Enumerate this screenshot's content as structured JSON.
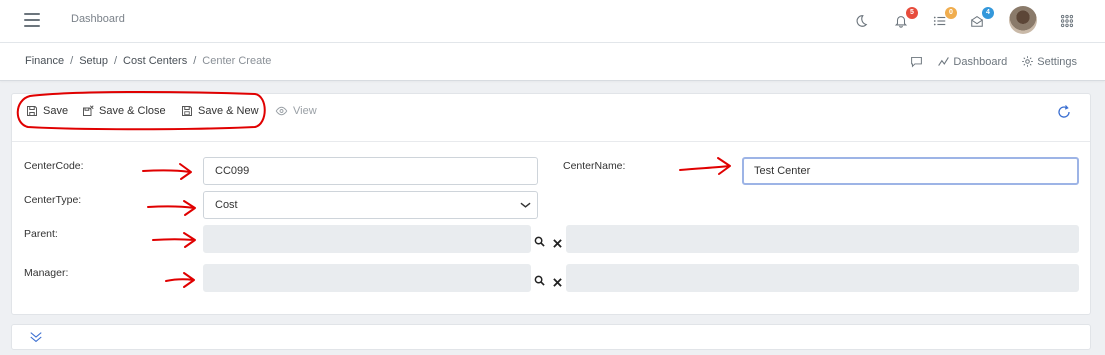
{
  "header": {
    "title": "Dashboard",
    "notifications_badge": "5",
    "tasks_badge": "0",
    "messages_badge": "4",
    "badge_colors": {
      "notifications": "#e74c3c",
      "tasks": "#f0ad4e",
      "messages": "#3498db"
    },
    "icons": [
      "menu-icon",
      "moon-icon",
      "bell-icon",
      "tasks-icon",
      "mail-icon",
      "avatar",
      "apps-grid-icon"
    ]
  },
  "breadcrumb": {
    "items": [
      "Finance",
      "Setup",
      "Cost Centers"
    ],
    "current": "Center Create",
    "separator": "/",
    "right_links": {
      "dashboard": "Dashboard",
      "settings": "Settings"
    }
  },
  "toolbar": {
    "save": "Save",
    "save_close": "Save & Close",
    "save_new": "Save & New",
    "view": "View"
  },
  "form": {
    "center_code": {
      "label": "CenterCode:",
      "value": "CC099"
    },
    "center_name": {
      "label": "CenterName:",
      "value": "Test Center"
    },
    "center_type": {
      "label": "CenterType:",
      "value": "Cost"
    },
    "parent": {
      "label": "Parent:",
      "value": "",
      "name_value": ""
    },
    "manager": {
      "label": "Manager:",
      "value": "",
      "name_value": ""
    }
  },
  "colors": {
    "annotation": "#e00000",
    "focus_border": "#9db4e6",
    "accent": "#3b6fd1"
  }
}
